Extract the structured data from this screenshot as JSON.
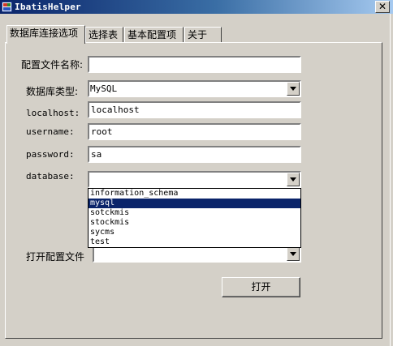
{
  "window": {
    "title": "IbatisHelper",
    "close_glyph": "✕"
  },
  "tabs": [
    {
      "label": "数据库连接选项",
      "active": true
    },
    {
      "label": "选择表",
      "active": false
    },
    {
      "label": "基本配置项",
      "active": false
    },
    {
      "label": "关于",
      "active": false
    }
  ],
  "form": {
    "config_name_label": "配置文件名称:",
    "config_name_value": "",
    "db_type_label": "数据库类型:",
    "db_type_value": "MySQL",
    "host_label": "localhost:",
    "host_value": "localhost",
    "username_label": "username:",
    "username_value": "root",
    "password_label": "password:",
    "password_value": "sa",
    "database_label": "database:",
    "database_value": "",
    "database_options": [
      "information_schema",
      "mysql",
      "sotckmis",
      "stockmis",
      "sycms",
      "test"
    ],
    "database_selected_index": 1,
    "open_config_label": "打开配置文件",
    "open_config_value": "",
    "open_button_label": "打开"
  },
  "icons": {
    "app": "app-icon",
    "close": "close-icon",
    "dropdown": "chevron-down-icon"
  },
  "colors": {
    "titlebar_start": "#0a246a",
    "titlebar_end": "#a6caf0",
    "face": "#d4d0c8",
    "selection": "#0a246a"
  }
}
